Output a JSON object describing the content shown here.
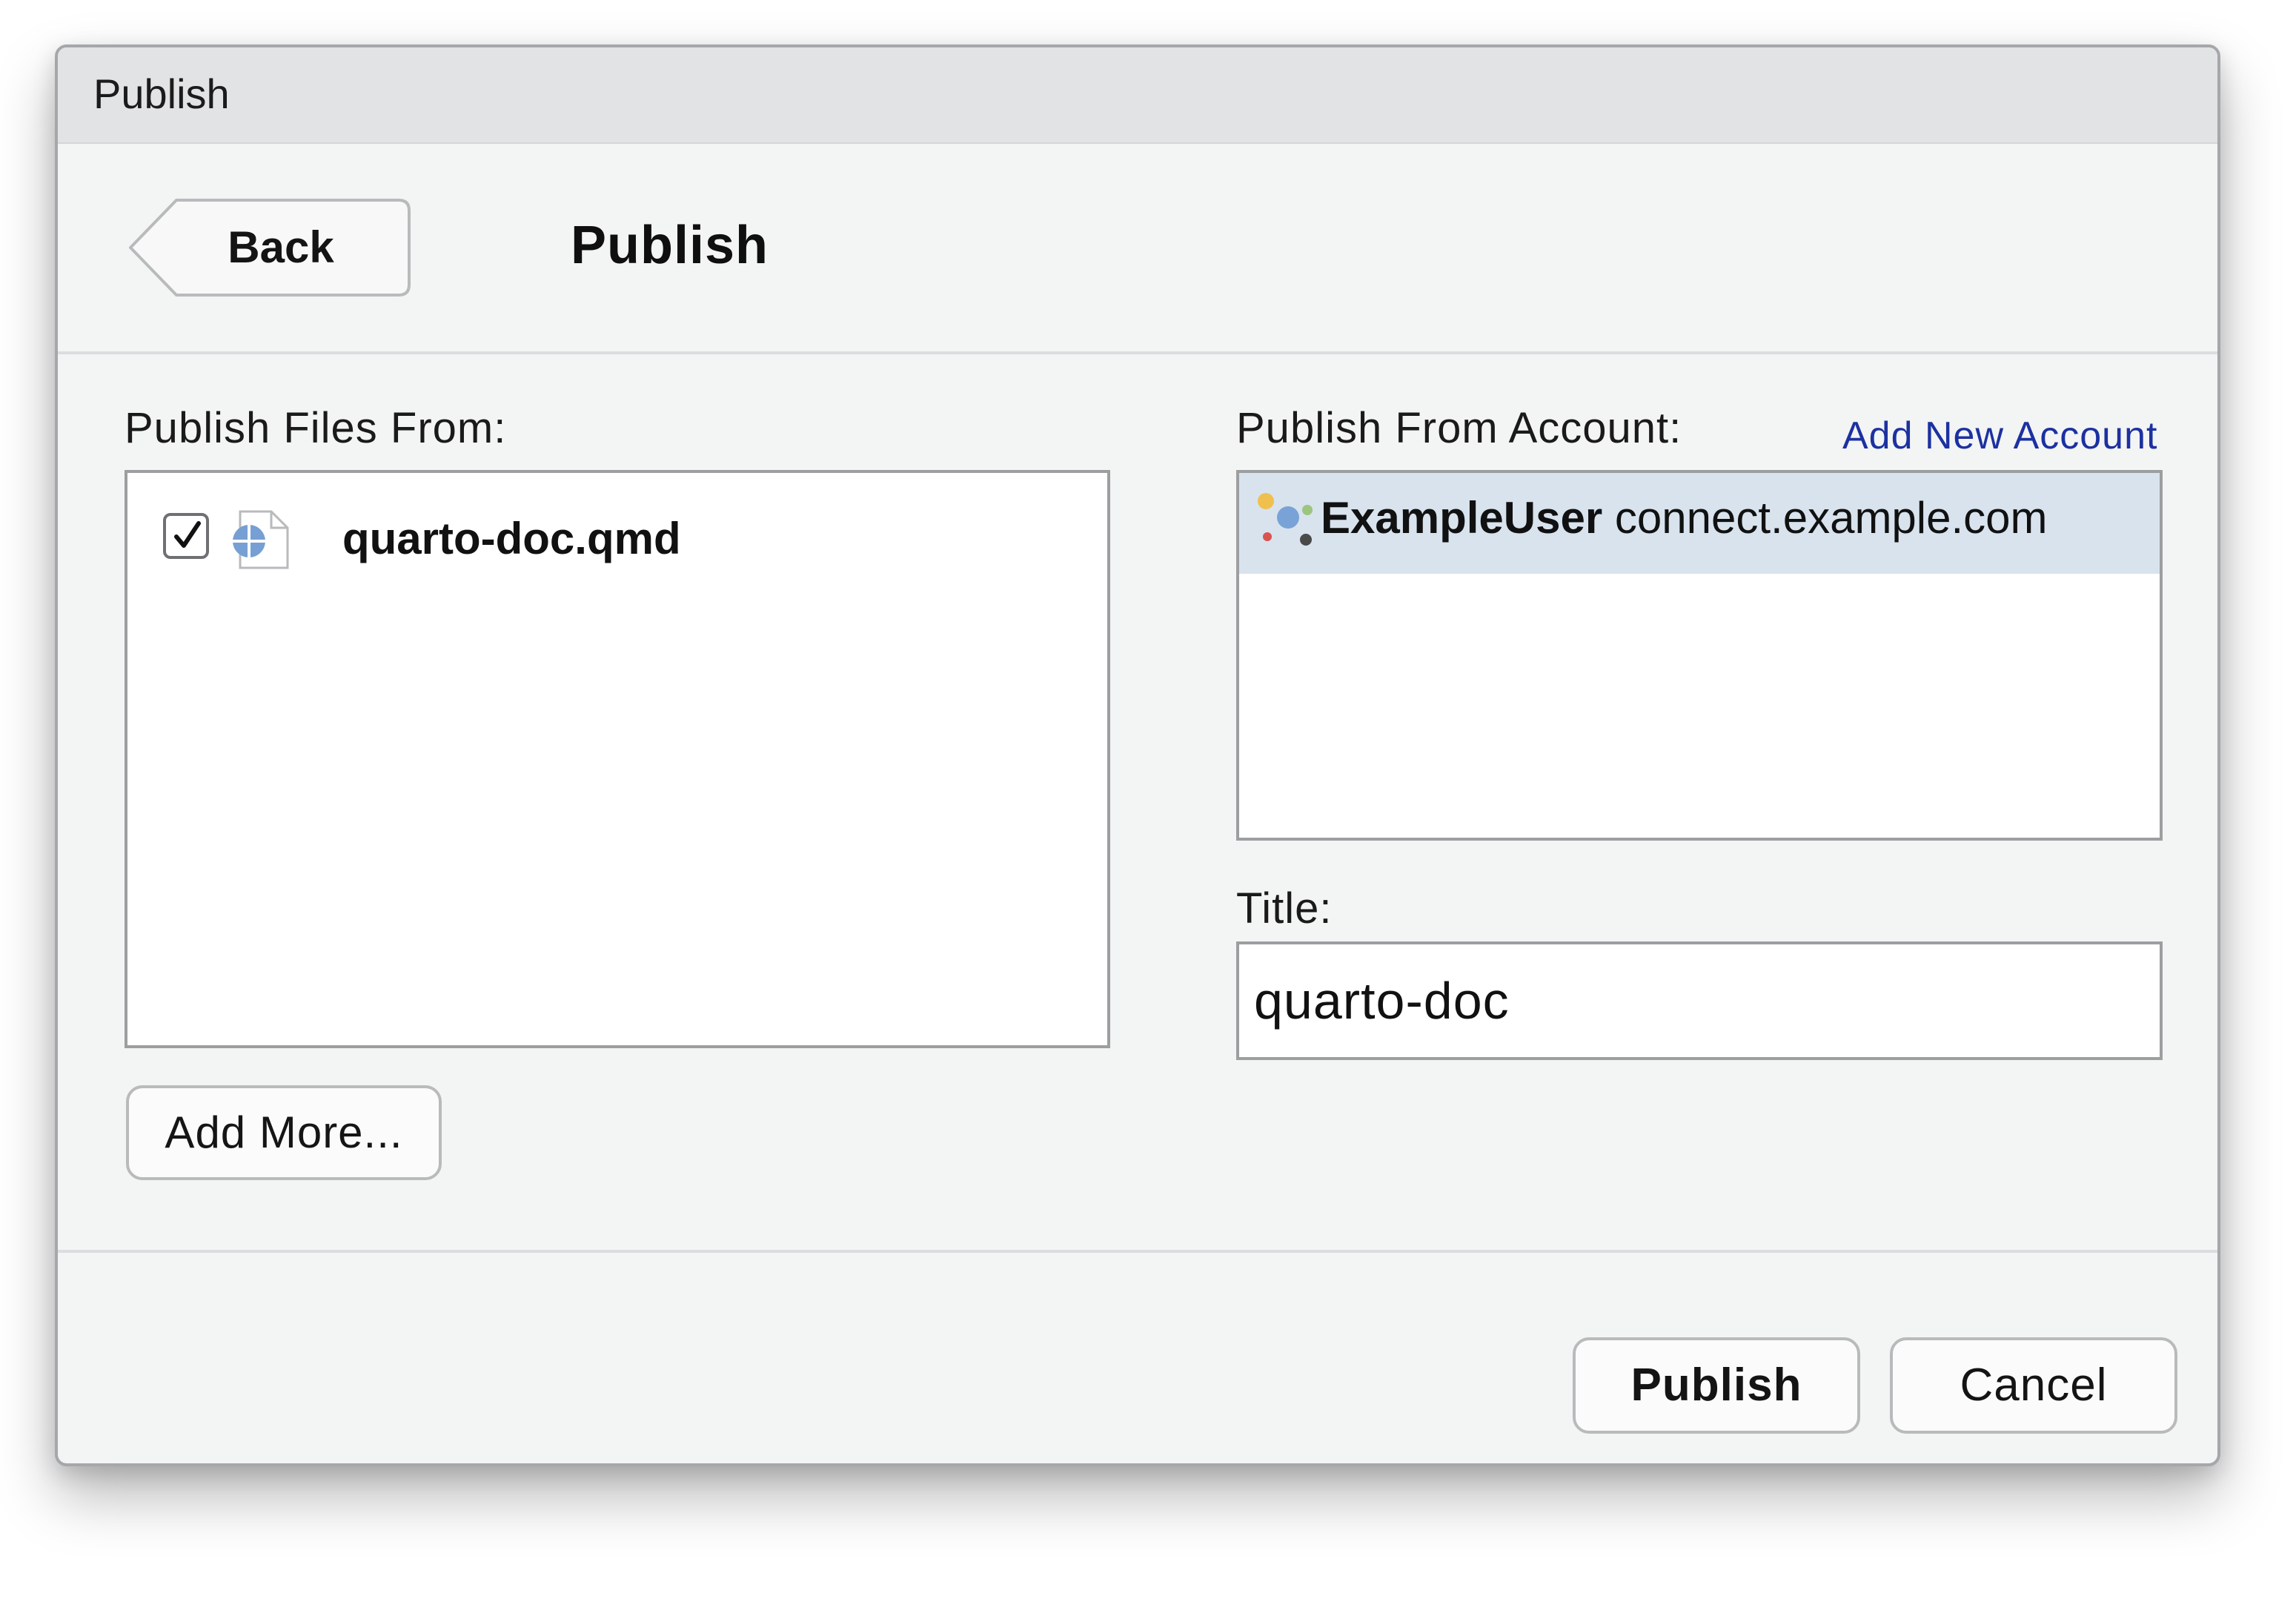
{
  "window": {
    "title": "Publish"
  },
  "header": {
    "back_label": "Back",
    "title": "Publish"
  },
  "files": {
    "label": "Publish Files From:",
    "items": [
      {
        "name": "quarto-doc.qmd",
        "checked": true,
        "icon": "quarto-file-icon"
      }
    ],
    "add_more_label": "Add More..."
  },
  "account": {
    "label": "Publish From Account:",
    "add_new_label": "Add New Account",
    "items": [
      {
        "user": "ExampleUser",
        "server": "connect.example.com",
        "selected": true,
        "icon": "posit-connect-icon"
      }
    ]
  },
  "title_field": {
    "label": "Title:",
    "value": "quarto-doc"
  },
  "footer": {
    "publish_label": "Publish",
    "cancel_label": "Cancel"
  },
  "colors": {
    "link": "#1c31a0",
    "selection": "#d8e3ee",
    "dialog_background": "#f3f4f4",
    "titlebar": "#e2e3e5"
  }
}
